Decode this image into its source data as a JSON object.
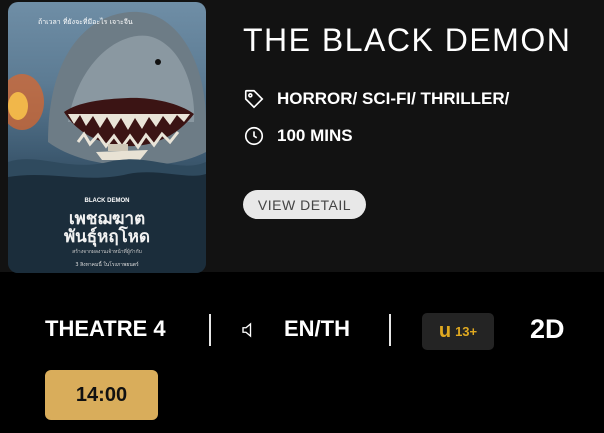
{
  "movie": {
    "title": "THE BLACK DEMON",
    "genre": "HORROR/ SCI-FI/ THRILLER/",
    "duration": "100 MINS",
    "detail_button": "VIEW DETAIL",
    "genre_icon": "tag-icon",
    "duration_icon": "clock-icon",
    "poster": {
      "tagline": "ถ้าเวลา ที่ยังจะที่มีอะไร เจาะจีน",
      "logo_en": "BLACK DEMON",
      "logo_th_line1": "เพชฌฆาต",
      "logo_th_line2": "พันธุ์หฤโหด",
      "credits_small": "สร้างจากผลงานเจ้าหน้าที่ผู้กำกับ",
      "release": "3 สิงหาคมนี้ ในโรงภาพยนตร์"
    }
  },
  "showtime": {
    "theatre": "THEATRE 4",
    "speaker_icon": "speaker-icon",
    "language": "EN/TH",
    "rating_letter": "u",
    "rating_age": "13+",
    "format": "2D",
    "times": [
      "14:00"
    ]
  },
  "colors": {
    "background": "#000000",
    "card": "#121212",
    "time_button": "#d9ad5b",
    "rating_text": "#e0a920"
  }
}
